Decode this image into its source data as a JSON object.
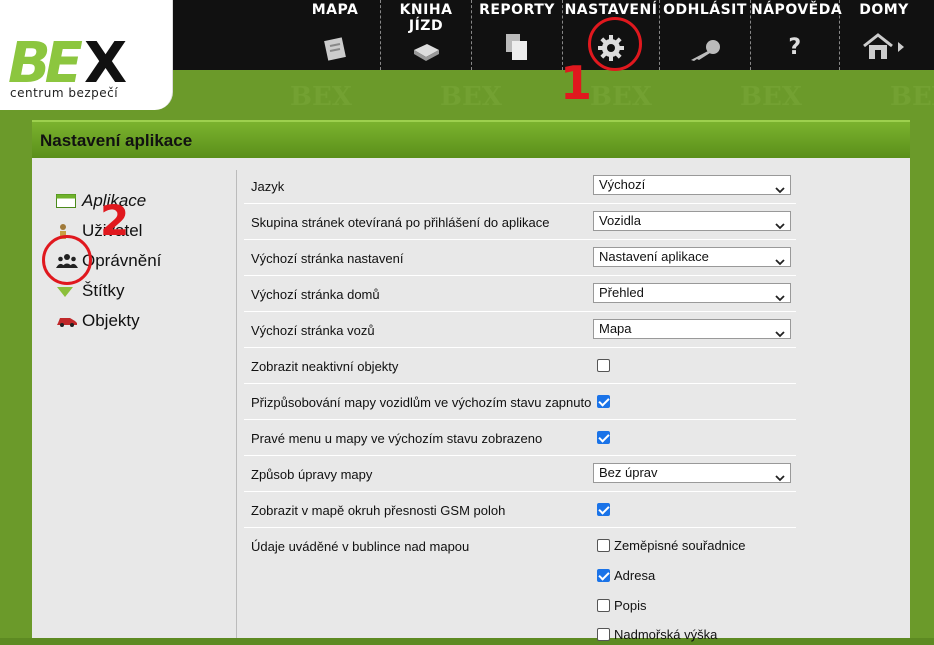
{
  "brand": {
    "logo_text": "BEX",
    "subtitle": "centrum bezpečí"
  },
  "nav": [
    {
      "label": "MAPA"
    },
    {
      "label": "KNIHA JÍZD"
    },
    {
      "label": "REPORTY"
    },
    {
      "label": "NASTAVENÍ"
    },
    {
      "label": "ODHLÁSIT"
    },
    {
      "label": "NÁPOVĚDA"
    },
    {
      "label": "DOMY"
    }
  ],
  "markers": {
    "one": "1",
    "two": "2"
  },
  "panel": {
    "title": "Nastavení aplikace"
  },
  "sidebar": [
    {
      "label": "Aplikace",
      "icon": "window-icon"
    },
    {
      "label": "Uživatel",
      "icon": "user-icon"
    },
    {
      "label": "Oprávnění",
      "icon": "users-icon"
    },
    {
      "label": "Štítky",
      "icon": "tag-icon"
    },
    {
      "label": "Objekty",
      "icon": "car-icon"
    }
  ],
  "settings": [
    {
      "label": "Jazyk",
      "type": "select",
      "value": "Výchozí"
    },
    {
      "label": "Skupina stránek otevíraná po přihlášení do aplikace",
      "type": "select",
      "value": "Vozidla"
    },
    {
      "label": "Výchozí stránka nastavení",
      "type": "select",
      "value": "Nastavení aplikace"
    },
    {
      "label": "Výchozí stránka domů",
      "type": "select",
      "value": "Přehled"
    },
    {
      "label": "Výchozí stránka vozů",
      "type": "select",
      "value": "Mapa"
    },
    {
      "label": "Zobrazit neaktivní objekty",
      "type": "checkbox",
      "checked": false
    },
    {
      "label": "Přizpůsobování mapy vozidlům ve výchozím stavu zapnuto",
      "type": "checkbox",
      "checked": true
    },
    {
      "label": "Pravé menu u mapy ve výchozím stavu zobrazeno",
      "type": "checkbox",
      "checked": true
    },
    {
      "label": "Způsob úpravy mapy",
      "type": "select",
      "value": "Bez úprav"
    },
    {
      "label": "Zobrazit v mapě okruh přesnosti GSM poloh",
      "type": "checkbox",
      "checked": true
    }
  ],
  "bubble": {
    "label": "Údaje uváděné v bublince nad mapou",
    "options": [
      {
        "label": "Zeměpisné souřadnice",
        "checked": false
      },
      {
        "label": "Adresa",
        "checked": true
      },
      {
        "label": "Popis",
        "checked": false
      },
      {
        "label": "Nadmořská výška",
        "checked": false
      }
    ]
  },
  "colors": {
    "accent_green": "#6b9a2a",
    "marker_red": "#e0181e",
    "check_blue": "#1a73e8"
  }
}
